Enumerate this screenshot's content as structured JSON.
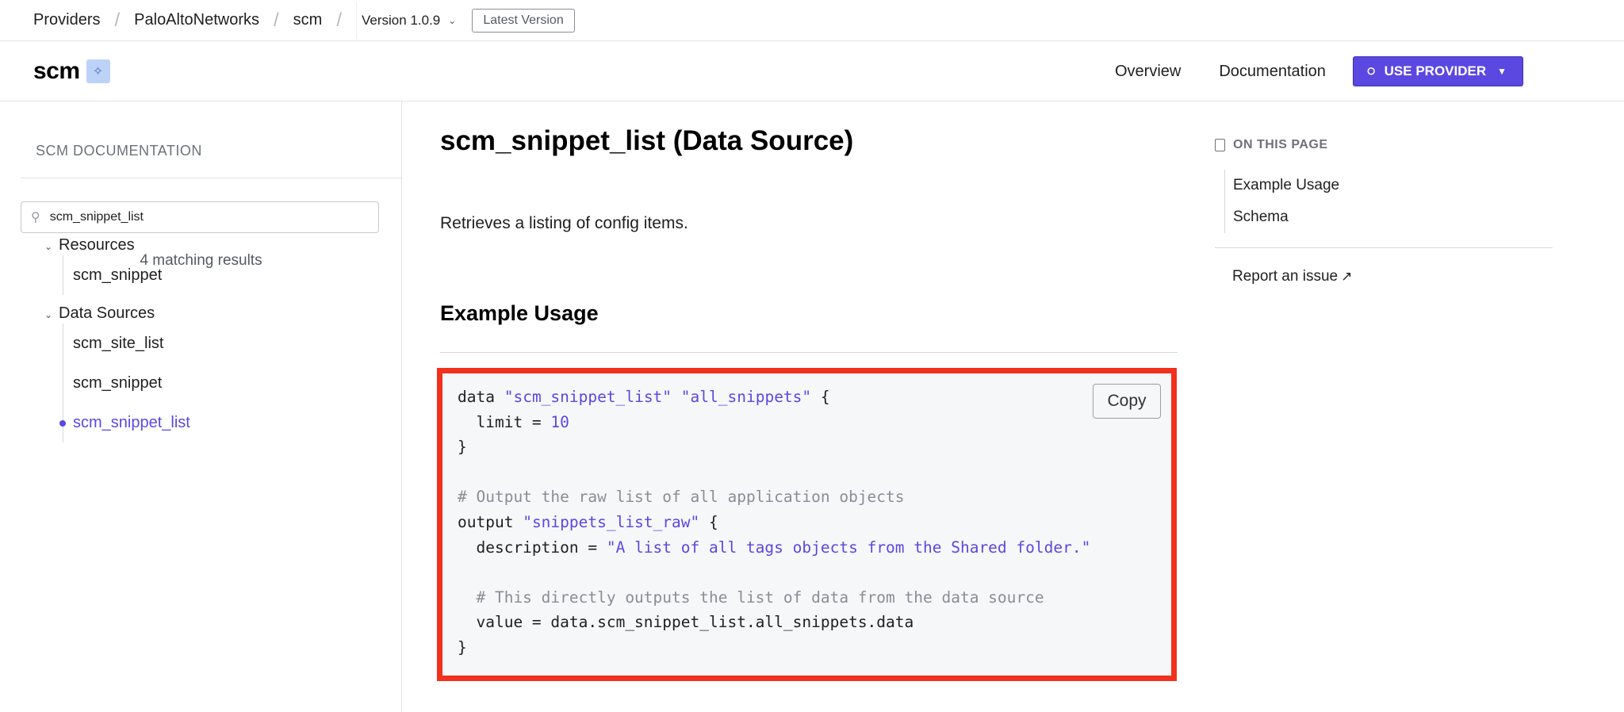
{
  "breadcrumbs": {
    "providers": "Providers",
    "namespace": "PaloAltoNetworks",
    "provider": "scm",
    "version": "Version 1.0.9",
    "latest": "Latest Version"
  },
  "header": {
    "provider_name": "scm",
    "nav": {
      "overview": "Overview",
      "documentation": "Documentation"
    },
    "use_provider": "USE PROVIDER"
  },
  "sidebar": {
    "title": "SCM DOCUMENTATION",
    "search_value": "scm_snippet_list",
    "matches": "4 matching results",
    "groups": [
      {
        "label": "Resources",
        "items": [
          "scm_snippet"
        ]
      },
      {
        "label": "Data Sources",
        "items": [
          "scm_site_list",
          "scm_snippet",
          "scm_snippet_list"
        ]
      }
    ],
    "active_item": "scm_snippet_list"
  },
  "main": {
    "title": "scm_snippet_list (Data Source)",
    "intro": "Retrieves a listing of config items.",
    "section_heading": "Example Usage",
    "copy_label": "Copy",
    "code": {
      "l1_kw": "data",
      "l1_type": "\"scm_snippet_list\"",
      "l1_name": "\"all_snippets\"",
      "l1_brace": "{",
      "l2_attr": "  limit = ",
      "l2_val": "10",
      "l3": "}",
      "l5_comment": "# Output the raw list of all application objects",
      "l6_kw": "output",
      "l6_name": "\"snippets_list_raw\"",
      "l6_brace": "{",
      "l7_attr": "  description = ",
      "l7_val": "\"A list of all tags objects from the Shared folder.\"",
      "l9_comment": "  # This directly outputs the list of data from the data source",
      "l10": "  value = data.scm_snippet_list.all_snippets.data",
      "l11": "}"
    }
  },
  "toc": {
    "title": "ON THIS PAGE",
    "items": [
      "Example Usage",
      "Schema"
    ],
    "report": "Report an issue"
  },
  "colors": {
    "accent": "#5b48e0",
    "highlight_border": "#f1301d",
    "code_bg": "#f6f7f9"
  },
  "icons": [
    "chevron-down-icon",
    "globe-icon",
    "caret-down-icon",
    "search-icon",
    "document-icon",
    "external-link-icon",
    "provider-badge-icon"
  ]
}
